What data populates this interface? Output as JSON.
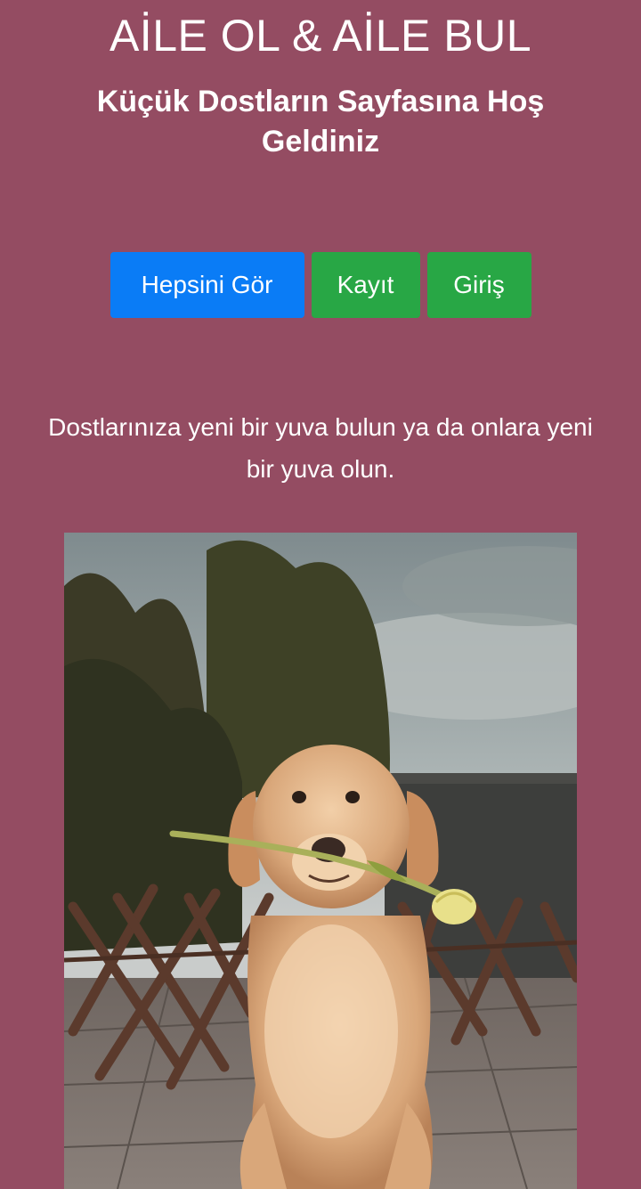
{
  "header": {
    "title": "AİLE OL & AİLE BUL",
    "subtitle": "Küçük Dostların Sayfasına Hoş Geldiniz"
  },
  "actions": {
    "view_all_label": "Hepsini Gör",
    "register_label": "Kayıt",
    "login_label": "Giriş"
  },
  "intro": {
    "text": "Dostlarınıza yeni bir yuva bulun ya da onlara yeni bir yuva olun."
  },
  "hero_image": {
    "subject": "golden-retriever-puppy-with-tulip"
  },
  "colors": {
    "background": "#944c62",
    "primary": "#0a7cf6",
    "success": "#28a745"
  }
}
